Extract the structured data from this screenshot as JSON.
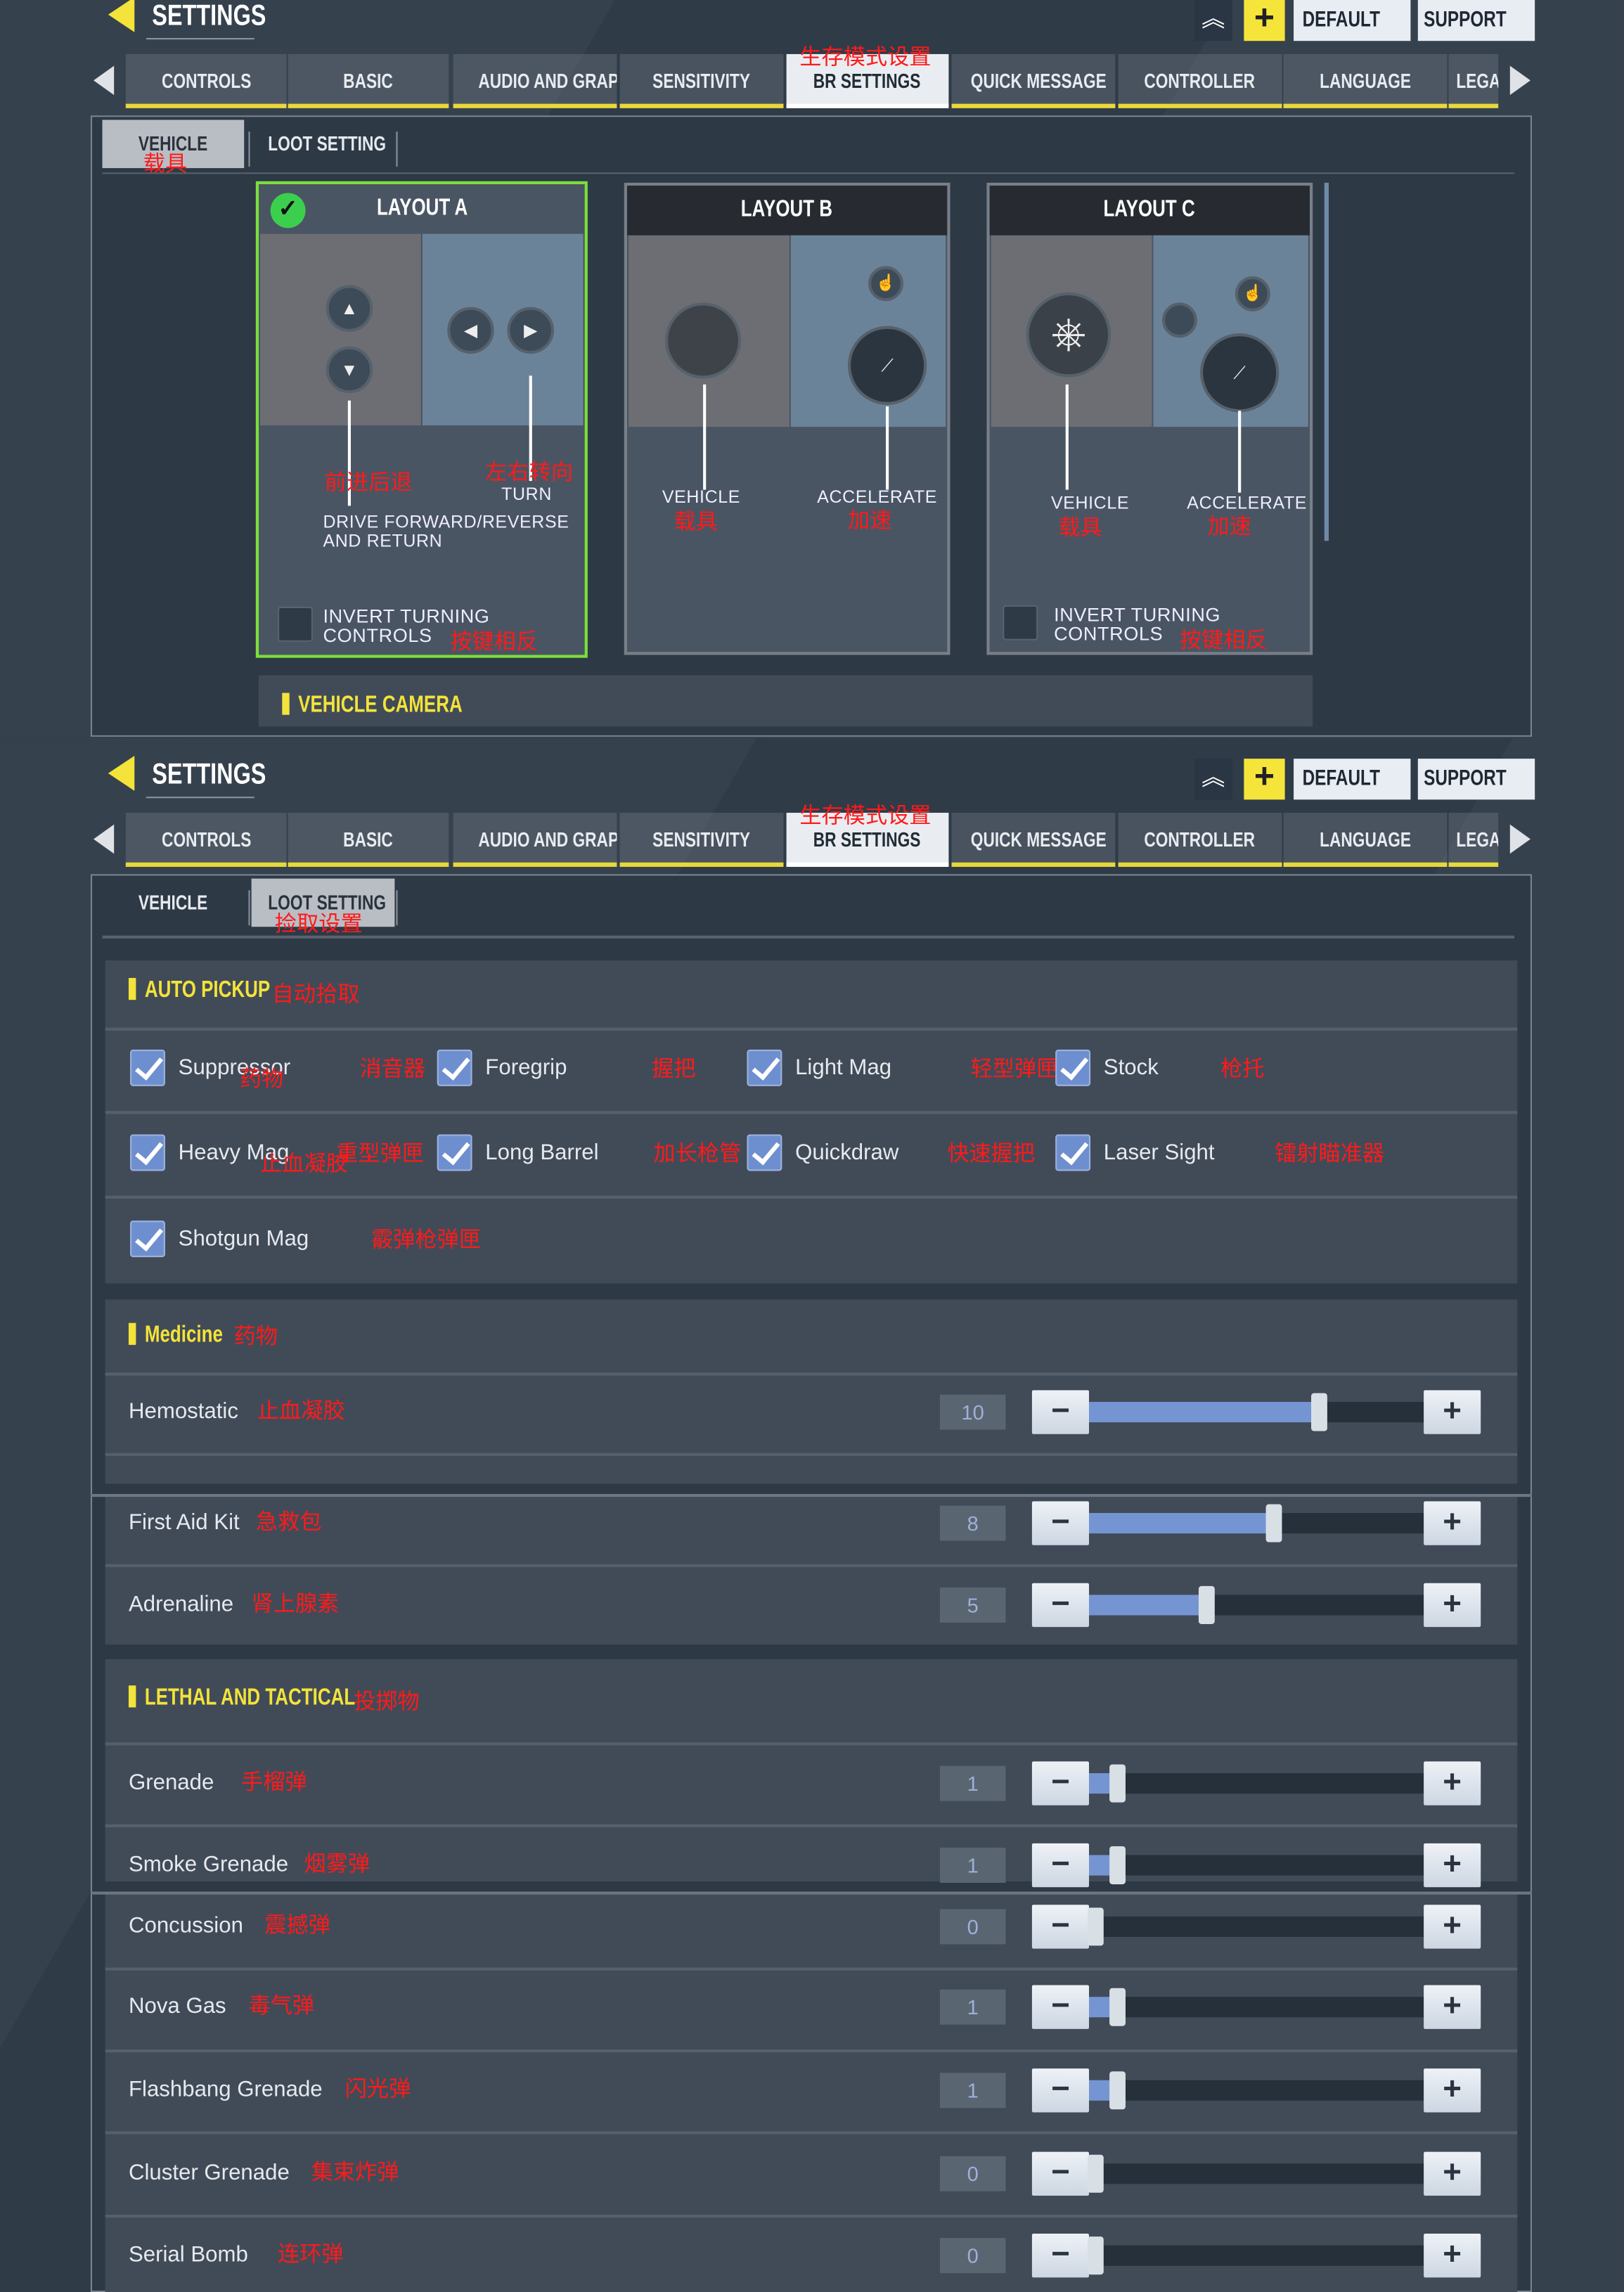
{
  "header": {
    "title": "SETTINGS",
    "rank_icon": "chevron-rank-icon",
    "add_icon": "plus-icon",
    "default_label": "DEFAULT",
    "support_label": "SUPPORT"
  },
  "tabs": {
    "items": [
      "CONTROLS",
      "BASIC",
      "AUDIO AND GRAPHICS",
      "SENSITIVITY",
      "BR SETTINGS",
      "QUICK MESSAGE",
      "CONTROLLER",
      "LANGUAGE",
      "LEGAL"
    ],
    "active_index": 4,
    "active_annotation": "生存模式设置"
  },
  "subtabs": [
    "VEHICLE",
    "LOOT SETTING"
  ],
  "vehicle_screen": {
    "active_subtab": 0,
    "subtab_annotation": "载具",
    "layouts": [
      {
        "title": "LAYOUT A",
        "selected": true,
        "left_label": "DRIVE FORWARD/REVERSE AND RETURN",
        "left_annotation": "前进后退",
        "right_label": "TURN",
        "right_annotation": "左右转向",
        "invert_label": "INVERT TURNING CONTROLS",
        "invert_annotation": "按键相反",
        "invert_checked": false
      },
      {
        "title": "LAYOUT B",
        "selected": false,
        "left_label": "VEHICLE",
        "left_annotation": "载具",
        "right_label": "ACCELERATE",
        "right_annotation": "加速"
      },
      {
        "title": "LAYOUT C",
        "selected": false,
        "left_label": "VEHICLE",
        "left_annotation": "载具",
        "right_label": "ACCELERATE",
        "right_annotation": "加速",
        "invert_label": "INVERT TURNING CONTROLS",
        "invert_annotation": "按键相反",
        "invert_checked": false
      }
    ],
    "camera_section": "VEHICLE CAMERA"
  },
  "loot_screen": {
    "active_subtab": 1,
    "subtab_annotation": "捡取设置",
    "auto_pickup": {
      "title": "AUTO PICKUP",
      "annotation": "自动拾取",
      "items": [
        {
          "label": "Suppressor",
          "annotation": "消音器",
          "checked": true
        },
        {
          "label": "Foregrip",
          "annotation": "握把",
          "checked": true
        },
        {
          "label": "Light Mag",
          "annotation": "轻型弹匣",
          "checked": true
        },
        {
          "label": "Stock",
          "annotation": "枪托",
          "checked": true
        },
        {
          "label": "Heavy Mag",
          "annotation": "重型弹匣",
          "checked": true
        },
        {
          "label": "Long Barrel",
          "annotation": "加长枪管",
          "checked": true
        },
        {
          "label": "Quickdraw",
          "annotation": "快速握把",
          "checked": true
        },
        {
          "label": "Laser Sight",
          "annotation": "镭射瞄准器",
          "checked": true
        },
        {
          "label": "Shotgun Mag",
          "annotation": "霰弹枪弹匣",
          "checked": true
        }
      ],
      "stray_annotations": [
        "药物",
        "止血凝胶"
      ]
    },
    "medicine": {
      "title": "Medicine",
      "annotation": "药物",
      "items": [
        {
          "label": "Hemostatic",
          "annotation": "止血凝胶",
          "value": 10
        },
        {
          "label": "First Aid Kit",
          "annotation": "急救包",
          "value": 8
        },
        {
          "label": "Adrenaline",
          "annotation": "肾上腺素",
          "value": 5
        }
      ]
    },
    "lethal": {
      "title": "LETHAL AND TACTICAL",
      "annotation": "投掷物",
      "items": [
        {
          "label": "Grenade",
          "annotation": "手榴弹",
          "value": 1
        },
        {
          "label": "Smoke Grenade",
          "annotation": "烟雾弹",
          "value": 1
        },
        {
          "label": "Concussion",
          "annotation": "震撼弹",
          "value": 0
        },
        {
          "label": "Nova Gas",
          "annotation": "毒气弹",
          "value": 1
        },
        {
          "label": "Flashbang Grenade",
          "annotation": "闪光弹",
          "value": 1
        },
        {
          "label": "Cluster Grenade",
          "annotation": "集束炸弹",
          "value": 0
        },
        {
          "label": "Serial Bomb",
          "annotation": "连环弹",
          "value": 0
        }
      ]
    },
    "minus_label": "−",
    "plus_label": "+"
  },
  "colors": {
    "accent": "#f3e33a",
    "selected_border": "#7be03a",
    "slider_fill": "#7595d2",
    "annotation": "#ff1a1a"
  }
}
